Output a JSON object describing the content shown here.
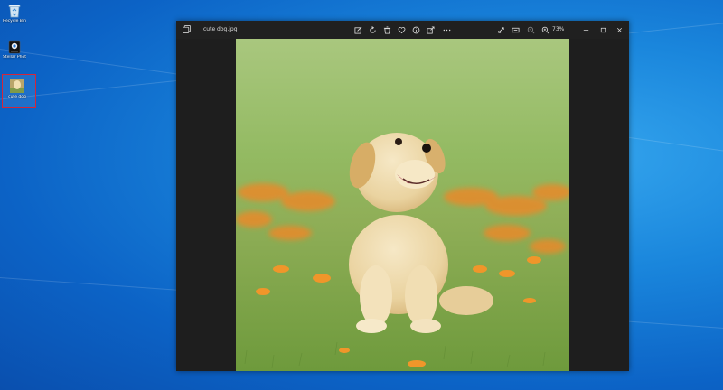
{
  "desktop": {
    "icons": [
      {
        "label": "Recycle Bin",
        "icon": "recycle-bin-icon"
      },
      {
        "label": "Stellar Photo Recovery",
        "icon": "app-shortcut-icon"
      },
      {
        "label": "cute dog",
        "icon": "image-file-icon"
      }
    ]
  },
  "window": {
    "file_name": "cute dog.jpg",
    "zoom": "73%",
    "toolbar": [
      "edit-icon",
      "rotate-icon",
      "delete-icon",
      "favorite-icon",
      "info-icon",
      "share-icon",
      "more-icon"
    ],
    "right_tools": [
      "fullscreen-icon",
      "slideshow-icon",
      "zoom-out-icon",
      "zoom-in-icon"
    ],
    "controls": [
      "minimize-icon",
      "maximize-icon",
      "close-icon"
    ]
  },
  "colors": {
    "accent": "#d4263a",
    "window_bg": "#1e1e1e",
    "desktop": "#1a86dc"
  }
}
